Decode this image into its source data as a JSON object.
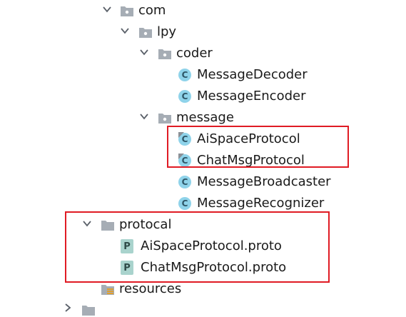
{
  "tree": {
    "com": {
      "label": "com",
      "expanded": true
    },
    "lpy": {
      "label": "lpy",
      "expanded": true
    },
    "coder": {
      "label": "coder",
      "expanded": true,
      "items": [
        {
          "label": "MessageDecoder",
          "icon": "class-icon",
          "icon_letter": "C"
        },
        {
          "label": "MessageEncoder",
          "icon": "class-icon",
          "icon_letter": "C"
        }
      ]
    },
    "message": {
      "label": "message",
      "expanded": true,
      "items": [
        {
          "label": "AiSpaceProtocol",
          "icon": "class-icon",
          "icon_letter": "C"
        },
        {
          "label": "ChatMsgProtocol",
          "icon": "class-icon",
          "icon_letter": "C"
        },
        {
          "label": "MessageBroadcaster",
          "icon": "class-icon",
          "icon_letter": "C"
        },
        {
          "label": "MessageRecognizer",
          "icon": "class-icon",
          "icon_letter": "C"
        }
      ]
    },
    "protocal": {
      "label": "protocal",
      "expanded": true,
      "items": [
        {
          "label": "AiSpaceProtocol.proto",
          "icon": "proto-file-icon",
          "icon_letter": "P"
        },
        {
          "label": "ChatMsgProtocol.proto",
          "icon": "proto-file-icon",
          "icon_letter": "P"
        }
      ]
    },
    "resources": {
      "label": "resources",
      "icon": "resources-folder-icon"
    }
  },
  "colors": {
    "folder": "#a6adb5",
    "class_icon_bg": "#8fd3ea",
    "proto_icon_bg": "#a9d3cd",
    "chevron": "#5a6069",
    "highlight_border": "#e01b24"
  }
}
